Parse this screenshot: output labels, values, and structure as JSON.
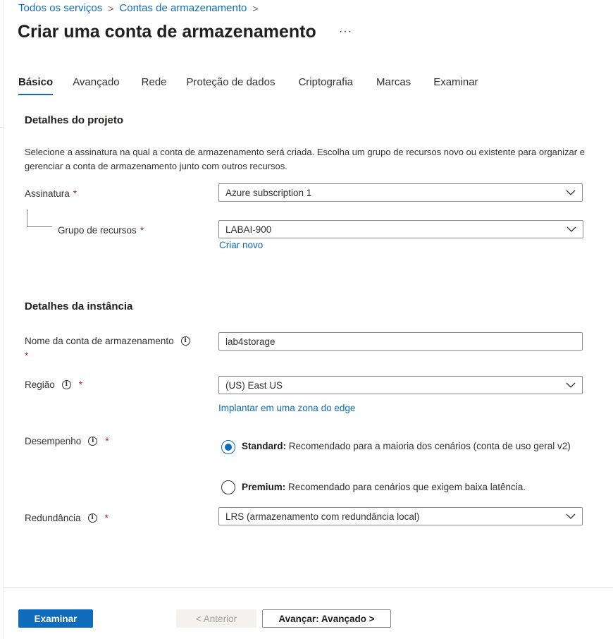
{
  "breadcrumb": {
    "items": [
      "Todos os serviços",
      "Contas de armazenamento"
    ],
    "separator": ">"
  },
  "page": {
    "title": "Criar uma conta de armazenamento",
    "more_label": "···"
  },
  "tabs": [
    {
      "label": "Básico",
      "active": true
    },
    {
      "label": "Avançado",
      "active": false
    },
    {
      "label": "Rede",
      "active": false
    },
    {
      "label": "Proteção de dados",
      "active": false
    },
    {
      "label": "Criptografia",
      "active": false
    },
    {
      "label": "Marcas",
      "active": false
    },
    {
      "label": "Examinar",
      "active": false
    }
  ],
  "project_details": {
    "title": "Detalhes do projeto",
    "description": "Selecione a assinatura na qual a conta de armazenamento será criada. Escolha um grupo de recursos novo ou existente para organizar e gerenciar a conta de armazenamento junto com outros recursos.",
    "subscription": {
      "label": "Assinatura",
      "required_mark": "*",
      "value": "Azure subscription 1"
    },
    "resource_group": {
      "label": "Grupo de recursos",
      "required_mark": "*",
      "value": "LABAI-900",
      "create_new_link": "Criar novo"
    }
  },
  "instance_details": {
    "title": "Detalhes da instância",
    "storage_name": {
      "label": "Nome da conta de armazenamento",
      "info_icon": "info-icon",
      "required_mark": "*",
      "value": "lab4storage"
    },
    "region": {
      "label": "Região",
      "info_icon": "info-icon",
      "required_mark": "*",
      "value": "(US) East US",
      "edge_link": "Implantar em uma zona do edge"
    },
    "performance": {
      "label": "Desempenho",
      "info_icon": "info-icon",
      "required_mark": "*",
      "options": [
        {
          "name": "Standard:",
          "text": " Recomendado para a maioria dos cenários (conta de uso geral v2)",
          "selected": true
        },
        {
          "name": "Premium:",
          "text": " Recomendado para cenários que exigem baixa latência.",
          "selected": false
        }
      ]
    },
    "redundancy": {
      "label": "Redundância",
      "info_icon": "info-icon",
      "required_mark": "*",
      "value": "LRS (armazenamento com redundância local)"
    }
  },
  "footer": {
    "review_button": "Examinar",
    "previous_button": "< Anterior",
    "next_button": "Avançar: Avançado >"
  },
  "colors": {
    "accent": "#0f6cbd",
    "required": "#a4262c",
    "border": "#8a8886"
  }
}
